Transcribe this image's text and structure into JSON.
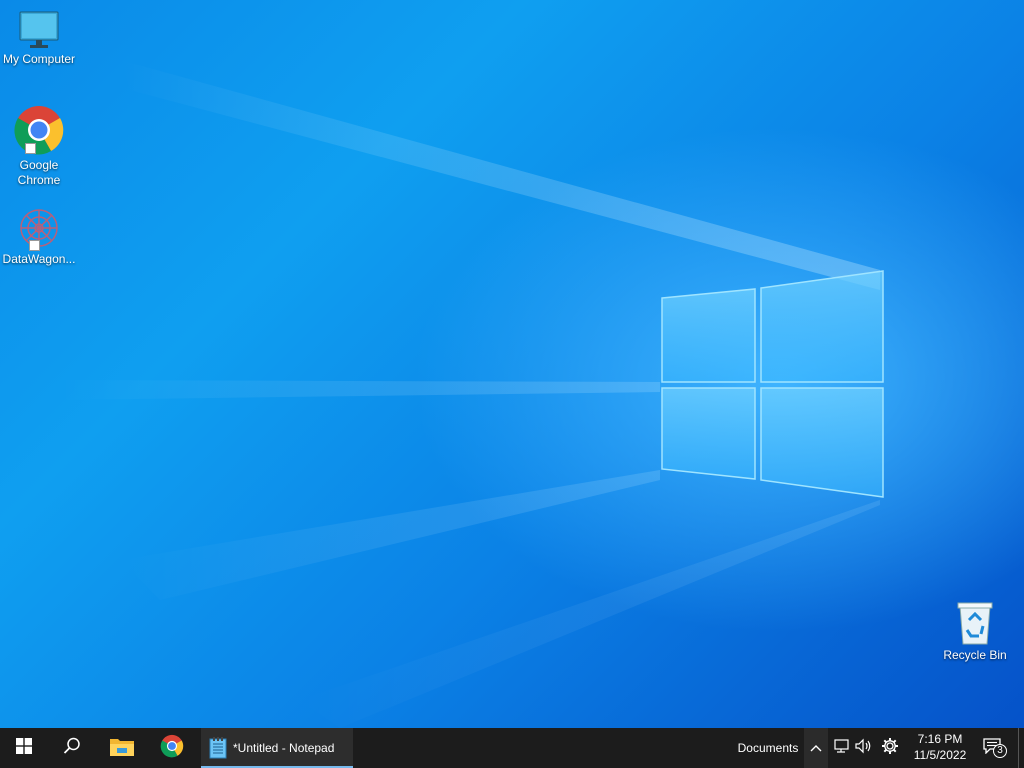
{
  "desktop": {
    "icons": [
      {
        "name": "my-computer",
        "label": "My Computer"
      },
      {
        "name": "google-chrome",
        "label": "Google Chrome"
      },
      {
        "name": "datawagon",
        "label": "DataWagon..."
      },
      {
        "name": "recycle-bin",
        "label": "Recycle Bin"
      }
    ]
  },
  "taskbar": {
    "start_icon": "windows-start-icon",
    "search_icon": "search-icon",
    "pinned": [
      {
        "name": "file-explorer",
        "icon": "folder-icon"
      },
      {
        "name": "chrome",
        "icon": "chrome-icon"
      }
    ],
    "active_app": {
      "title": "*Untitled - Notepad",
      "icon": "notepad-icon"
    },
    "toolbar_label": "Documents",
    "tray": {
      "show_hidden_icon": "chevron-up-icon",
      "network_icon": "network-icon",
      "volume_icon": "volume-icon",
      "settings_icon": "gear-icon"
    },
    "clock": {
      "time": "7:16 PM",
      "date": "11/5/2022"
    },
    "notifications": {
      "count": "3"
    }
  },
  "colors": {
    "taskbar_bg": "#1c1c1c",
    "accent_underline": "#76b9ed",
    "desktop_blue": "#0b82e6"
  }
}
